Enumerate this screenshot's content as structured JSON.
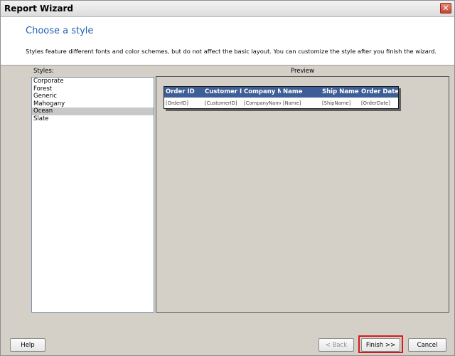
{
  "window": {
    "title": "Report Wizard"
  },
  "header": {
    "title": "Choose a style",
    "description": "Styles feature different fonts and color schemes, but do not affect the basic layout. You can customize the style after you finish the wizard."
  },
  "styles": {
    "label": "Styles:",
    "items": [
      "Corporate",
      "Forest",
      "Generic",
      "Mahogany",
      "Ocean",
      "Slate"
    ],
    "selected": "Ocean"
  },
  "preview": {
    "label": "Preview",
    "columns": [
      "Order ID",
      "Customer I",
      "Company N",
      "Name",
      "Ship Name",
      "Order Date"
    ],
    "cells": [
      "[OrderID]",
      "[CustomerID]",
      "[CompanyName",
      "[Name]",
      "[ShipName]",
      "[OrderDate]"
    ],
    "header_color": "#3d5e96"
  },
  "buttons": {
    "help": "Help",
    "back": "< Back",
    "finish": "Finish >>",
    "cancel": "Cancel"
  },
  "colors": {
    "accent_title": "#1f5fb5",
    "highlight": "#d41c1c"
  }
}
